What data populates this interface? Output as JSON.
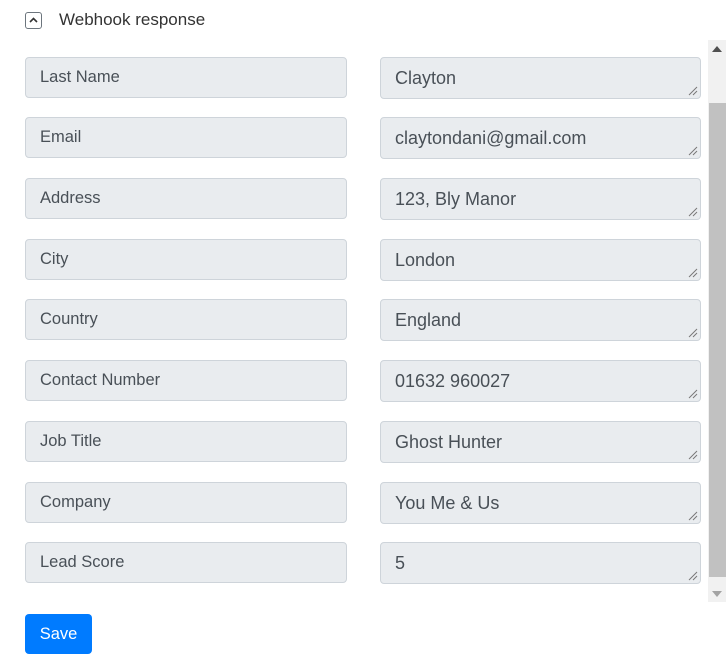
{
  "section": {
    "title": "Webhook response",
    "toggle_icon": "chevron-up-icon"
  },
  "fields": [
    {
      "label": "Last Name",
      "value": "Clayton"
    },
    {
      "label": "Email",
      "value": "claytondani@gmail.com"
    },
    {
      "label": "Address",
      "value": "123, Bly Manor"
    },
    {
      "label": "City",
      "value": "London"
    },
    {
      "label": "Country",
      "value": "England"
    },
    {
      "label": "Contact Number",
      "value": "01632 960027"
    },
    {
      "label": "Job Title",
      "value": "Ghost Hunter"
    },
    {
      "label": "Company",
      "value": "You Me & Us"
    },
    {
      "label": "Lead Score",
      "value": "5"
    }
  ],
  "actions": {
    "save_label": "Save"
  },
  "colors": {
    "primary": "#007bff",
    "field_bg": "#e9ecef",
    "field_border": "#ced4da"
  }
}
